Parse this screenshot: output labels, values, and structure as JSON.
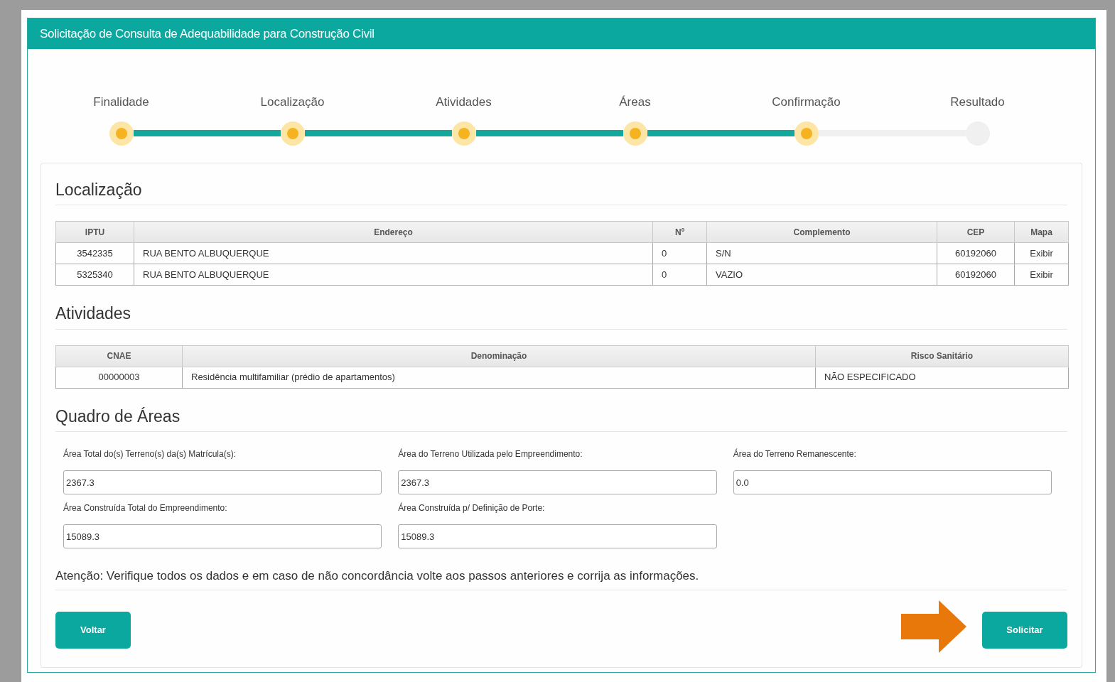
{
  "panel": {
    "title": "Solicitação de Consulta de Adequabilidade para Construção Civil"
  },
  "steps": [
    {
      "label": "Finalidade",
      "done": true
    },
    {
      "label": "Localização",
      "done": true
    },
    {
      "label": "Atividades",
      "done": true
    },
    {
      "label": "Áreas",
      "done": true
    },
    {
      "label": "Confirmação",
      "done": true
    },
    {
      "label": "Resultado",
      "done": false
    }
  ],
  "localizacao": {
    "heading": "Localização",
    "columns": [
      "IPTU",
      "Endereço",
      "Nº",
      "Complemento",
      "CEP",
      "Mapa"
    ],
    "rows": [
      [
        "3542335",
        "RUA BENTO ALBUQUERQUE",
        "0",
        "S/N",
        "60192060",
        "Exibir"
      ],
      [
        "5325340",
        "RUA BENTO ALBUQUERQUE",
        "0",
        "VAZIO",
        "60192060",
        "Exibir"
      ]
    ]
  },
  "atividades": {
    "heading": "Atividades",
    "columns": [
      "CNAE",
      "Denominação",
      "Risco Sanitário"
    ],
    "rows": [
      [
        "00000003",
        "Residência multifamiliar (prédio de apartamentos)",
        "NÃO ESPECIFICADO"
      ]
    ]
  },
  "areas": {
    "heading": "Quadro de Áreas",
    "fields": [
      {
        "label": "Área Total do(s) Terreno(s) da(s) Matrícula(s):",
        "value": "2367.3"
      },
      {
        "label": "Área do Terreno Utilizada pelo Empreendimento:",
        "value": "2367.3"
      },
      {
        "label": "Área do Terreno Remanescente:",
        "value": "0.0"
      },
      {
        "label": "Área Construída Total do Empreendimento:",
        "value": "15089.3"
      },
      {
        "label": "Área Construída p/ Definição de Porte:",
        "value": "15089.3"
      }
    ]
  },
  "notice": "Atenção: Verifique todos os dados e em caso de não concordância volte aos passos anteriores e corrija as informações.",
  "buttons": {
    "back": "Voltar",
    "submit": "Solicitar"
  }
}
